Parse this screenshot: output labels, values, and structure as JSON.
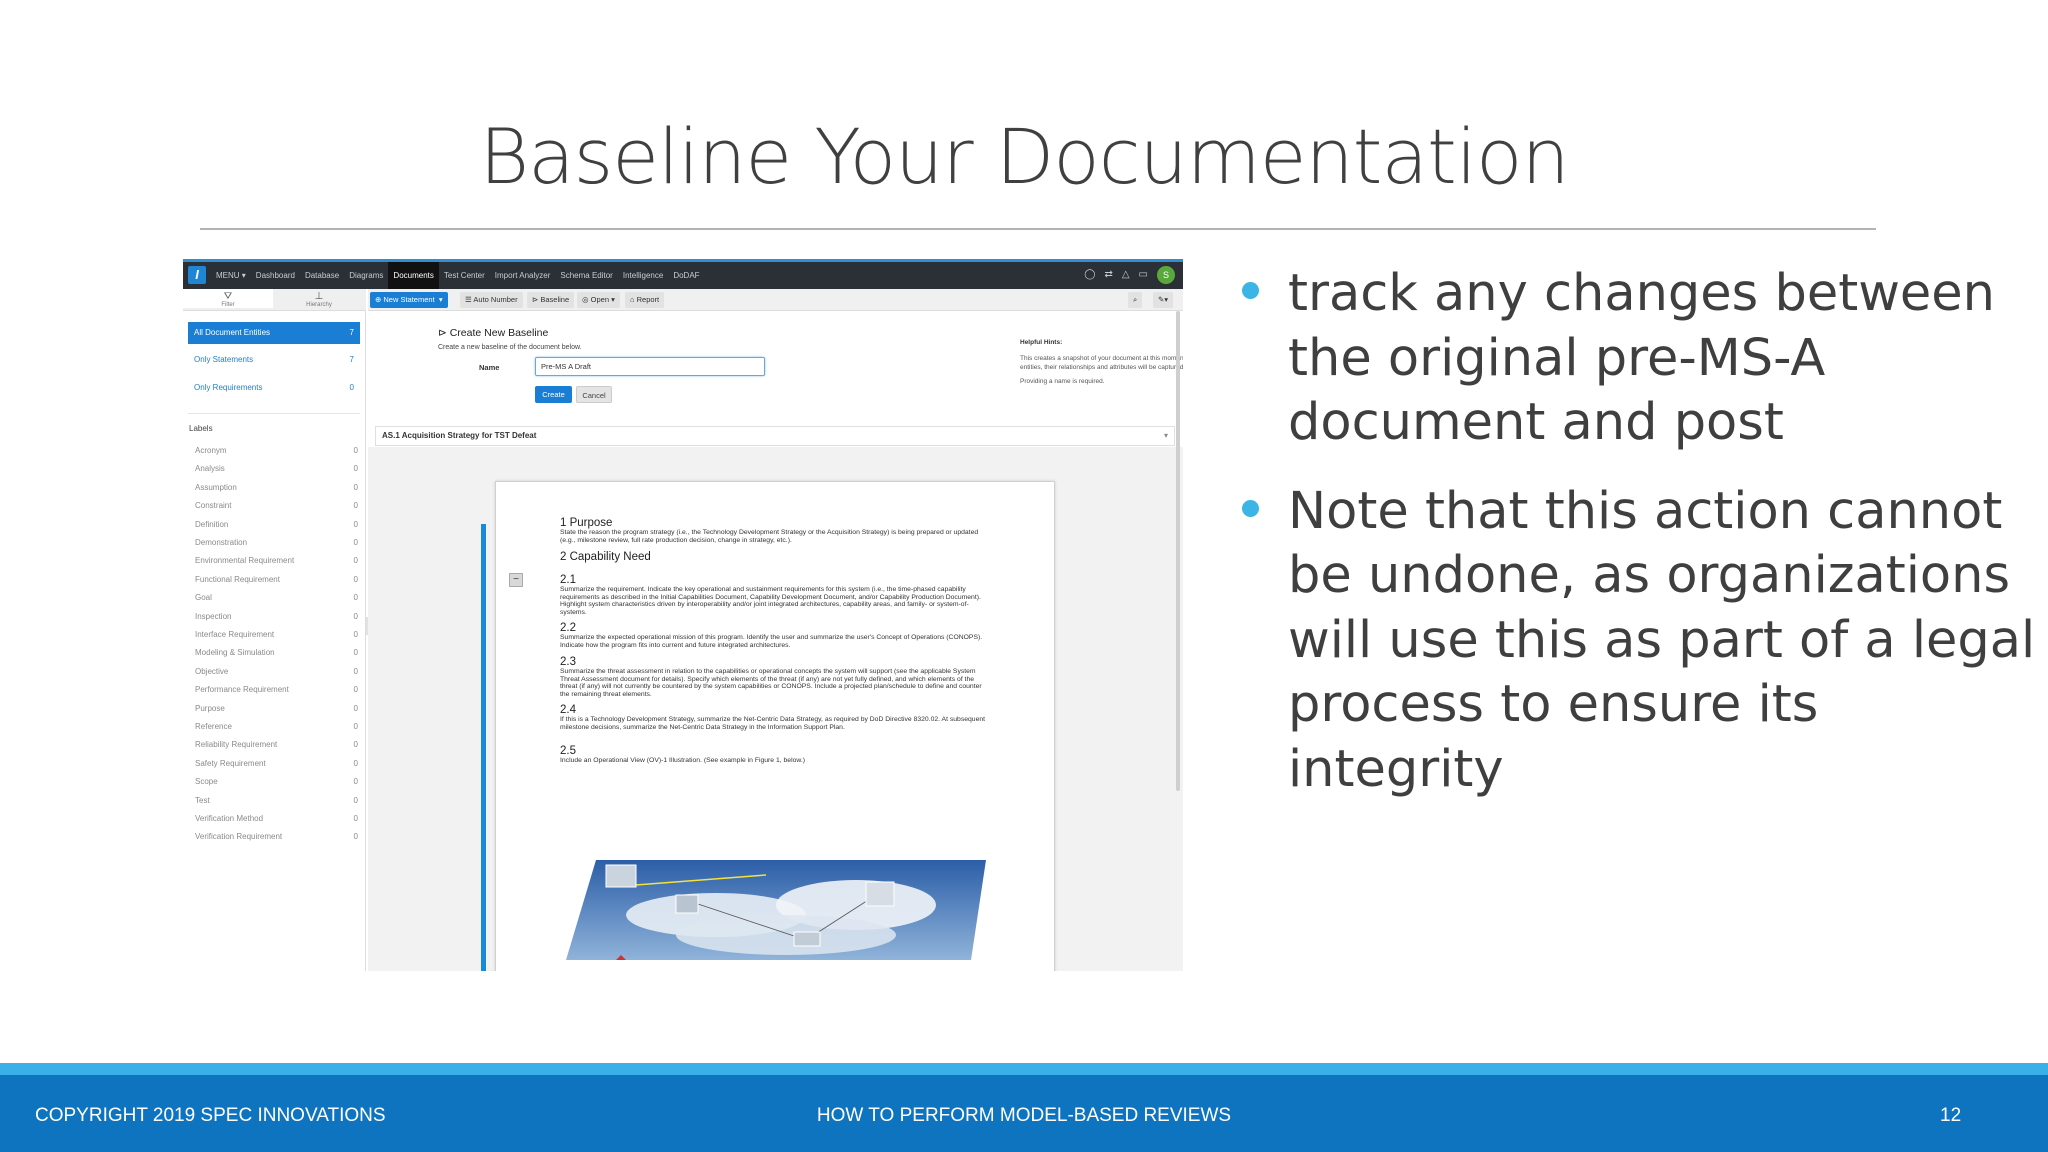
{
  "slide": {
    "title": "Baseline Your Documentation",
    "bullets": [
      "track any changes between the original pre-MS-A document and post",
      "Note that this action cannot be undone, as organizations will use this as part of a legal process to ensure its integrity"
    ],
    "footer": {
      "left": "COPYRIGHT 2019 SPEC INNOVATIONS",
      "center": "HOW TO PERFORM MODEL-BASED REVIEWS",
      "page": "12"
    },
    "accent_color": "#0f74c0",
    "bullet_color": "#3cb4e5"
  },
  "app": {
    "logo": "I",
    "nav": [
      "MENU ▾",
      "Dashboard",
      "Database",
      "Diagrams",
      "Documents",
      "Test Center",
      "Import Analyzer",
      "Schema Editor",
      "Intelligence",
      "DoDAF"
    ],
    "active_nav": "Documents",
    "user_initial": "S",
    "sidebar_tabs": [
      "Filter",
      "Hierarchy"
    ],
    "entities": [
      {
        "label": "All Document Entities",
        "count": "7"
      },
      {
        "label": "Only Statements",
        "count": "7"
      },
      {
        "label": "Only Requirements",
        "count": "0"
      }
    ],
    "labels_heading": "Labels",
    "labels": [
      {
        "name": "Acronym",
        "count": "0"
      },
      {
        "name": "Analysis",
        "count": "0"
      },
      {
        "name": "Assumption",
        "count": "0"
      },
      {
        "name": "Constraint",
        "count": "0"
      },
      {
        "name": "Definition",
        "count": "0"
      },
      {
        "name": "Demonstration",
        "count": "0"
      },
      {
        "name": "Environmental Requirement",
        "count": "0"
      },
      {
        "name": "Functional Requirement",
        "count": "0"
      },
      {
        "name": "Goal",
        "count": "0"
      },
      {
        "name": "Inspection",
        "count": "0"
      },
      {
        "name": "Interface Requirement",
        "count": "0"
      },
      {
        "name": "Modeling & Simulation",
        "count": "0"
      },
      {
        "name": "Objective",
        "count": "0"
      },
      {
        "name": "Performance Requirement",
        "count": "0"
      },
      {
        "name": "Purpose",
        "count": "0"
      },
      {
        "name": "Reference",
        "count": "0"
      },
      {
        "name": "Reliability Requirement",
        "count": "0"
      },
      {
        "name": "Safety Requirement",
        "count": "0"
      },
      {
        "name": "Scope",
        "count": "0"
      },
      {
        "name": "Test",
        "count": "0"
      },
      {
        "name": "Verification Method",
        "count": "0"
      },
      {
        "name": "Verification Requirement",
        "count": "0"
      }
    ],
    "toolbar": {
      "new_statement": "New Statement",
      "auto_number": "Auto Number",
      "baseline": "Baseline",
      "open": "Open ▾",
      "report": "Report"
    },
    "baseline_form": {
      "title": "Create New Baseline",
      "subtitle": "Create a new baseline of the document below.",
      "name_label": "Name",
      "name_value": "Pre-MS A Draft",
      "create": "Create",
      "cancel": "Cancel",
      "hints_title": "Helpful Hints:",
      "hint_1": "This creates a snapshot of your document at this moment in time. All document entities, their relationships and attributes will be captured.",
      "hint_2": "Providing a name is required."
    },
    "document_title": "AS.1 Acquisition Strategy for TST Defeat",
    "sections": [
      {
        "heading": "1 Purpose",
        "body": "State the reason the program strategy (i.e., the Technology Development Strategy or the Acquisition Strategy) is being prepared or updated (e.g., milestone review, full rate production decision, change in strategy, etc.)."
      },
      {
        "heading": "2 Capability Need",
        "body": ""
      },
      {
        "heading": "2.1",
        "body": "Summarize the requirement. Indicate the key operational and sustainment requirements for this system (i.e., the time-phased capability requirements as described in the Initial Capabilities Document, Capability Development Document, and/or Capability Production Document). Highlight system characteristics driven by interoperability and/or joint integrated architectures, capability areas, and family- or system-of-systems."
      },
      {
        "heading": "2.2",
        "body": "Summarize the expected operational mission of this program. Identify the user and summarize the user's Concept of Operations (CONOPS). Indicate how the program fits into current and future integrated architectures."
      },
      {
        "heading": "2.3",
        "body": "Summarize the threat assessment in relation to the capabilities or operational concepts the system will support (see the applicable System Threat Assessment document for details). Specify which elements of the threat (if any) are not yet fully defined, and which elements of the threat (if any) will not currently be countered by the system capabilities or CONOPS. Include a projected plan/schedule to define and counter the remaining threat elements."
      },
      {
        "heading": "2.4",
        "body": "If this is a Technology Development Strategy, summarize the Net-Centric Data Strategy, as required by DoD Directive 8320.02. At subsequent milestone decisions, summarize the Net-Centric Data Strategy in the Information Support Plan."
      },
      {
        "heading": "2.5",
        "body": "Include an Operational View (OV)-1 Illustration. (See example in Figure 1, below.)"
      }
    ]
  }
}
